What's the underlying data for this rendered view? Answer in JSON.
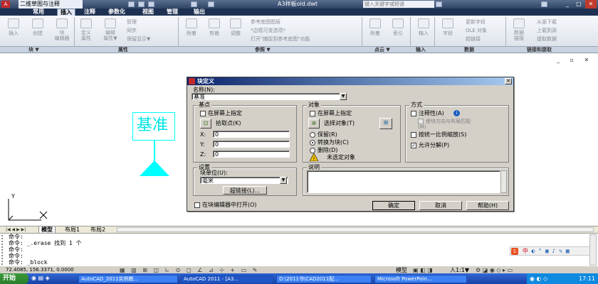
{
  "titlebar": {
    "workspace": "二维草图与注释",
    "filename": "A3样板old.dwt",
    "search_placeholder": "键入关键字或短语"
  },
  "ribbon_tabs": [
    "常用",
    "插入",
    "注释",
    "参数化",
    "视图",
    "管理",
    "输出"
  ],
  "ribbon_active_tab": "插入",
  "ribbon": {
    "block_buttons": [
      "插入",
      "创建",
      "块\n编辑器"
    ],
    "attr_buttons": [
      "定义\n属性",
      "编辑\n属性▼"
    ],
    "attr_small": [
      "管理",
      "同步",
      "保留显示▼"
    ],
    "ref_buttons": [
      "附着",
      "剪裁",
      "调整"
    ],
    "ref_small": [
      "参考底图图层",
      "*边框可变选项*",
      "打开\"捕捉到参考底图\"功能"
    ],
    "pointcloud_buttons": [
      "附着",
      "索引"
    ],
    "import_buttons": [
      "输入"
    ],
    "data_buttons": [
      "字段"
    ],
    "data_small": [
      "更新字段",
      "OLE 对象",
      "超链接"
    ],
    "data_link_button": "数据\n链接",
    "link_small": [
      "从源下载",
      "上载到源",
      "提取数据"
    ]
  },
  "ribbon_panels": [
    "块 ▼",
    "属性",
    "参照 ▼",
    "点云 ▼",
    "输入",
    "数据",
    "链接和提取"
  ],
  "canvas": {
    "block_text": "基准",
    "ucs_y": "Y",
    "ucs_x": "X"
  },
  "dialog": {
    "title": "块定义",
    "name_label": "名称(N):",
    "name_value": "基准",
    "basepoint": {
      "title": "基点",
      "specify_on_screen": "在屏幕上指定",
      "pick_point": "拾取点(K)",
      "x_label": "X:",
      "x_value": "0",
      "y_label": "Y:",
      "y_value": "0",
      "z_label": "Z:",
      "z_value": "0"
    },
    "objects": {
      "title": "对象",
      "specify_on_screen": "在屏幕上指定",
      "select_objects": "选择对象(T)",
      "retain": "保留(R)",
      "convert": "转换为块(C)",
      "delete": "删除(D)",
      "none_selected": "未选定对象"
    },
    "behavior": {
      "title": "方式",
      "annotative": "注释性(A)",
      "match_orientation": "使块方向与布局匹配(M)",
      "scale_uniformly": "按统一比例缩放(S)",
      "allow_exploding": "允许分解(P)"
    },
    "settings": {
      "title": "设置",
      "block_unit_label": "块单位(U):",
      "block_unit_value": "毫米",
      "hyperlink": "超链接(L)..."
    },
    "description": {
      "title": "说明"
    },
    "open_in_editor": "在块编辑器中打开(O)",
    "ok": "确定",
    "cancel": "取消",
    "help": "帮助(H)"
  },
  "layout_tabs": [
    "模型",
    "布局1",
    "布局2"
  ],
  "command_lines": [
    "命令:",
    "命令: _.erase 找到 1 个",
    "命令:",
    "命令:",
    "命令: _block",
    "命令:"
  ],
  "statusbar": {
    "coords": "72.4085, 156.3371, 0.0000",
    "model": "模型",
    "scale": "人1:1▼"
  },
  "taskbar": {
    "start": "开始",
    "tasks": [
      "AutoCAD_2011实例教...",
      "AutoCAD 2011 - [A3...",
      "D:\\2011书\\CAD2011配...",
      "Microsoft PowerPoin..."
    ],
    "clock": "17:11"
  },
  "ime": {
    "label": "中"
  }
}
